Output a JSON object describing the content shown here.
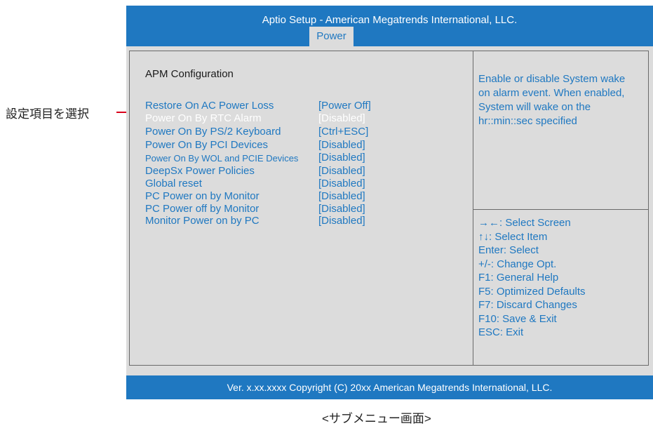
{
  "window": {
    "title": "Aptio Setup -  American Megatrends International, LLC.",
    "active_tab": "Power"
  },
  "section": {
    "title": "APM  Configuration"
  },
  "settings": [
    {
      "label": "Restore On AC Power Loss",
      "value": "[Power Off]",
      "selected": false
    },
    {
      "label": "Power On By RTC Alarm",
      "value": "[Disabled]",
      "selected": true
    },
    {
      "label": "Power On By PS/2 Keyboard",
      "value": "[Ctrl+ESC]",
      "selected": false
    },
    {
      "label": "Power On By PCI Devices",
      "value": "[Disabled]",
      "selected": false
    },
    {
      "label": "Power On By WOL and PCIE Devices",
      "value": "[Disabled]",
      "selected": false
    },
    {
      "label": "DeepSx Power Policies",
      "value": "[Disabled]",
      "selected": false
    },
    {
      "label": "Global reset",
      "value": "[Disabled]",
      "selected": false
    },
    {
      "label": "PC Power on by Monitor",
      "value": "[Disabled]",
      "selected": false
    },
    {
      "label": "PC Power off by Monitor",
      "value": "[Disabled]",
      "selected": false
    },
    {
      "label": "Monitor Power on by PC",
      "value": "[Disabled]",
      "selected": false
    }
  ],
  "help": {
    "lines": [
      "Enable or disable System wake",
      "on alarm event. When enabled,",
      "System will wake on the",
      "hr::min::sec specified"
    ]
  },
  "keys": [
    "→←: Select Screen",
    "↑↓: Select Item",
    "Enter: Select",
    "+/-: Change Opt.",
    "F1: General Help",
    "F5: Optimized Defaults",
    "F7: Discard Changes",
    "F10: Save & Exit",
    "ESC: Exit"
  ],
  "footer": {
    "text": "Ver. x.xx.xxxx Copyright (C) 20xx American Megatrends International, LLC."
  },
  "annotation": {
    "text": "設定項目を選択"
  },
  "caption": {
    "text": "<サブメニュー画面>"
  },
  "colors": {
    "accent_blue": "#1f78c1",
    "panel_gray": "#dcdcdc",
    "annotation_red": "#d9001b"
  }
}
